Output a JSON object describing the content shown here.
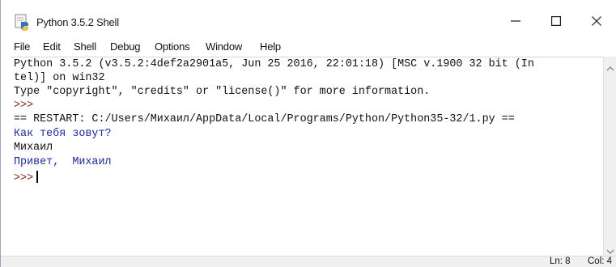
{
  "window": {
    "title": "Python 3.5.2 Shell",
    "controls": {
      "minimize": "—",
      "maximize": "☐",
      "close": "✕"
    }
  },
  "menu": [
    "File",
    "Edit",
    "Shell",
    "Debug",
    "Options",
    "Window",
    "Help"
  ],
  "shell": {
    "lines": [
      {
        "text": "Python 3.5.2 (v3.5.2:4def2a2901a5, Jun 25 2016, 22:01:18) [MSC v.1900 32 bit (In",
        "style": "black"
      },
      {
        "text": "tel)] on win32",
        "style": "black"
      },
      {
        "text": "Type \"copyright\", \"credits\" or \"license()\" for more information.",
        "style": "black"
      },
      {
        "text": ">>>",
        "style": "prompt"
      },
      {
        "text": "== RESTART: C:/Users/Михаил/AppData/Local/Programs/Python/Python35-32/1.py ==",
        "style": "black"
      },
      {
        "text": "Как тебя зовут?",
        "style": "blue"
      },
      {
        "text": "Михаил",
        "style": "black"
      },
      {
        "text": "Привет,  Михаил",
        "style": "blue"
      },
      {
        "text": ">>>",
        "style": "prompt"
      }
    ]
  },
  "status": {
    "line": "Ln: 8",
    "column": "Col: 4"
  },
  "colors": {
    "output_text": "#111111",
    "prompt": "#8b1a1a",
    "stdout_blue": "#1e2c9a",
    "status_bg": "#f0f0f0"
  },
  "icons": {
    "app": "python-idle-icon",
    "scroll_up": "arrow-up-icon",
    "scroll_down": "arrow-down-icon"
  }
}
